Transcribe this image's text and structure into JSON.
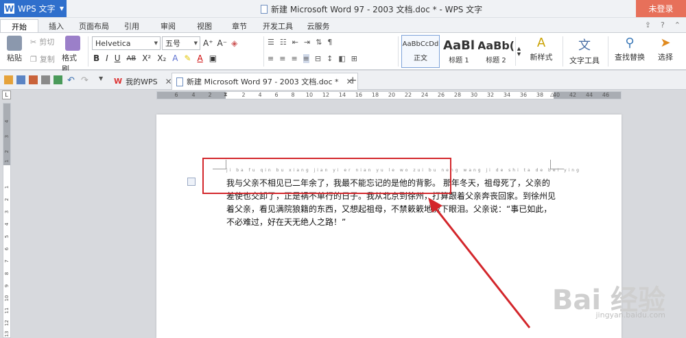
{
  "titlebar": {
    "app_name": "WPS 文字",
    "window_title": "新建 Microsoft Word 97 - 2003 文档.doc * - WPS 文字",
    "login_label": "未登录"
  },
  "menu": {
    "tabs": [
      "开始",
      "插入",
      "页面布局",
      "引用",
      "审阅",
      "视图",
      "章节",
      "开发工具",
      "云服务"
    ]
  },
  "ribbon": {
    "paste": "粘贴",
    "cut": "剪切",
    "copy": "复制",
    "format_painter": "格式刷",
    "font_name": "Helvetica",
    "font_size": "五号",
    "styles": [
      {
        "preview": "AaBbCcDd",
        "label": "正文"
      },
      {
        "preview": "AaBl",
        "label": "标题 1"
      },
      {
        "preview": "AaBb(",
        "label": "标题 2"
      }
    ],
    "new_style": "新样式",
    "text_tools": "文字工具",
    "find_replace": "查找替换",
    "select": "选择"
  },
  "tabs_bar": {
    "wps_tab": "我的WPS",
    "doc_tab": "新建 Microsoft Word 97 - 2003 文档.doc *"
  },
  "ruler": {
    "h_labels": [
      "6",
      "4",
      "2",
      "",
      "2",
      "4",
      "6",
      "8",
      "10",
      "12",
      "14",
      "16",
      "18",
      "20",
      "22",
      "24",
      "26",
      "28",
      "30",
      "32",
      "34",
      "36",
      "38",
      "40",
      "42",
      "44",
      "46"
    ],
    "v_labels": [
      "4",
      "3",
      "2",
      "1",
      "",
      "1",
      "2",
      "3",
      "4",
      "5",
      "6",
      "7",
      "8",
      "9",
      "10",
      "11",
      "12",
      "13"
    ]
  },
  "document": {
    "phonetic_text": "ji ba fu qin bu xiang jian yi er nian yu le   wo zui bu neng wang ji de shi ta de bei ying",
    "lines": [
      "我与父亲不相见已二年余了，我最不能忘记的是他的背影。 那年冬天，祖母死了，父亲的",
      "差使也交卸了，正是祸不单行的日子。我从北京到徐州，打算跟着父亲奔丧回家。到徐州见",
      "着父亲，看见满院狼籍的东西，又想起祖母，不禁簌簌地流下眼泪。父亲说：“事已如此，",
      "不必难过，好在天无绝人之路！”"
    ]
  },
  "watermark": {
    "brand": "Bai 经验",
    "url": "jingyan.baidu.com"
  },
  "colors": {
    "app_blue": "#2f6fcc",
    "login_red": "#e7705a",
    "annotation_red": "#d3262b"
  }
}
